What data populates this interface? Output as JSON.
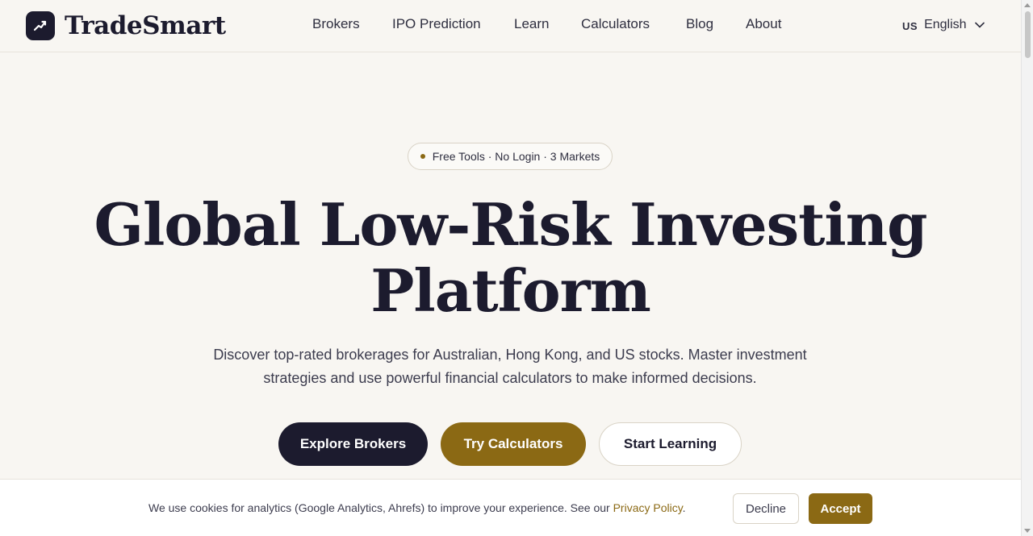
{
  "brand": {
    "name": "TradeSmart",
    "icon": "chart-trend-icon"
  },
  "nav": {
    "items": [
      {
        "label": "Brokers"
      },
      {
        "label": "IPO Prediction"
      },
      {
        "label": "Learn"
      },
      {
        "label": "Calculators"
      },
      {
        "label": "Blog"
      },
      {
        "label": "About"
      }
    ],
    "language": {
      "code": "US",
      "label": "English",
      "icon": "chevron-down-icon"
    }
  },
  "hero": {
    "badge": "Free Tools · No Login · 3 Markets",
    "title_line1": "Global Low-Risk Investing",
    "title_line2": "Platform",
    "subtitle_line1": "Discover top-rated brokerages for Australian, Hong Kong, and US stocks. Master investment",
    "subtitle_line2": "strategies and use powerful financial calculators to make informed decisions.",
    "buttons": {
      "explore": "Explore Brokers",
      "calculators": "Try Calculators",
      "learning": "Start Learning"
    }
  },
  "cookie": {
    "text": "We use cookies for analytics (Google Analytics, Ahrefs) to improve your experience. See our ",
    "link": "Privacy Policy",
    "after": ".",
    "decline": "Decline",
    "accept": "Accept"
  },
  "colors": {
    "navy": "#1c1b2e",
    "gold": "#8b6914",
    "background": "#f8f6f2"
  }
}
